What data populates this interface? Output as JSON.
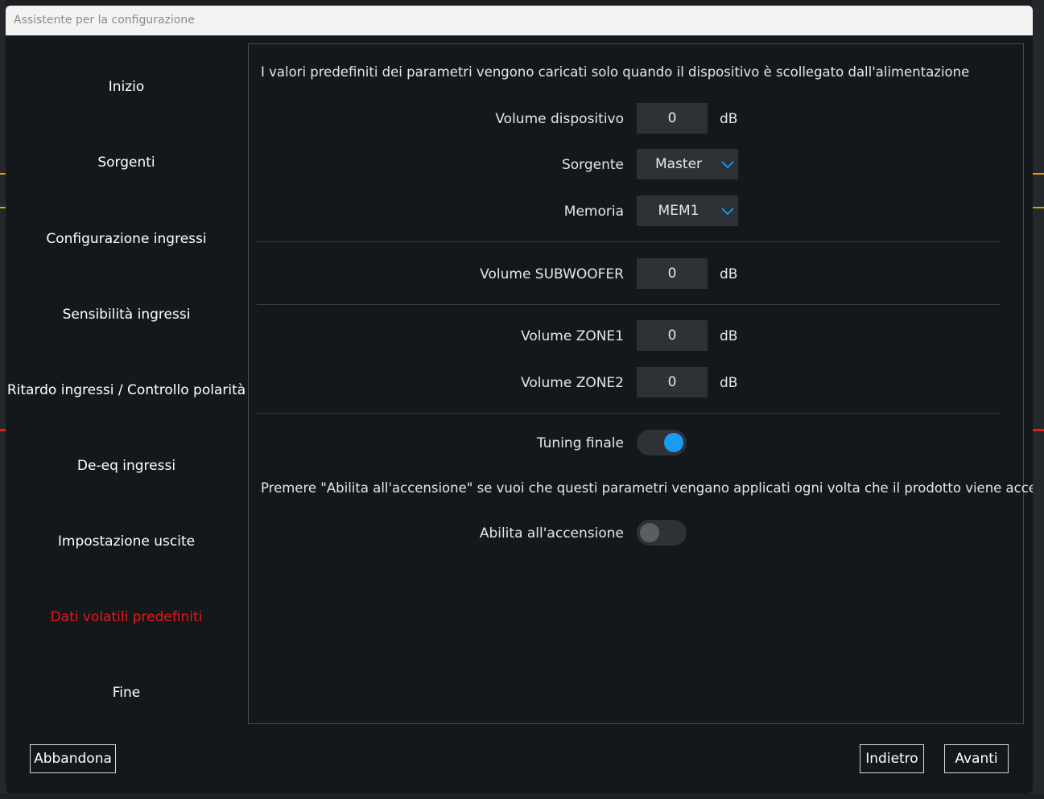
{
  "window": {
    "title": "Assistente per la configurazione"
  },
  "nav": {
    "items": [
      {
        "label": "Inizio"
      },
      {
        "label": "Sorgenti"
      },
      {
        "label": "Configurazione ingressi"
      },
      {
        "label": "Sensibilità ingressi"
      },
      {
        "label": "Ritardo ingressi / Controllo polarità"
      },
      {
        "label": "De-eq ingressi"
      },
      {
        "label": "Impostazione uscite"
      },
      {
        "label": "Dati volatili predefiniti"
      },
      {
        "label": "Fine"
      }
    ],
    "active_index": 7,
    "active_color": "#e8161b"
  },
  "panel": {
    "intro": "I valori predefiniti dei parametri vengono caricati solo quando il dispositivo è scollegato dall'alimentazione",
    "device_volume": {
      "label": "Volume dispositivo",
      "value": "0",
      "unit": "dB"
    },
    "source": {
      "label": "Sorgente",
      "value": "Master"
    },
    "memory": {
      "label": "Memoria",
      "value": "MEM1"
    },
    "subwoofer_volume": {
      "label": "Volume SUBWOOFER",
      "value": "0",
      "unit": "dB"
    },
    "zone1_volume": {
      "label": "Volume ZONE1",
      "value": "0",
      "unit": "dB"
    },
    "zone2_volume": {
      "label": "Volume ZONE2",
      "value": "0",
      "unit": "dB"
    },
    "final_tuning": {
      "label": "Tuning finale",
      "on": true
    },
    "power_on_note": "Premere \"Abilita all'accensione\" se vuoi che questi parametri vengano applicati ogni volta che il prodotto viene acceso.",
    "enable_on_power": {
      "label": "Abilita all'accensione",
      "on": false
    }
  },
  "footer": {
    "abandon_label": "Abbandona",
    "back_label": "Indietro",
    "next_label": "Avanti"
  },
  "colors": {
    "accent": "#1a9bf5",
    "active_nav": "#e8161b"
  }
}
